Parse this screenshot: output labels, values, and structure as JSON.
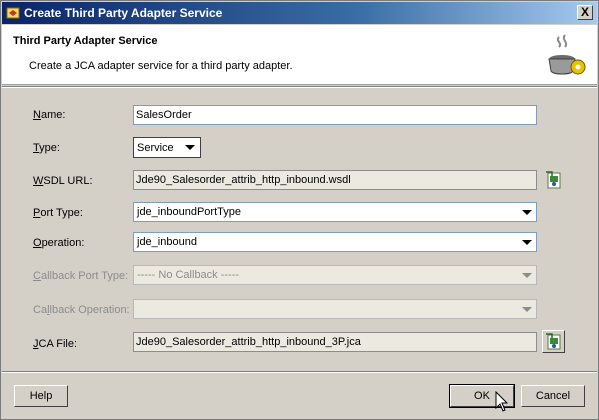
{
  "window": {
    "title": "Create Third Party Adapter Service",
    "close_label": "X"
  },
  "header": {
    "title": "Third Party Adapter Service",
    "subtitle": "Create a JCA adapter service for a third party adapter."
  },
  "form": {
    "name": {
      "label_first": "N",
      "label_rest": "ame:",
      "value": "SalesOrder"
    },
    "type": {
      "label_first": "T",
      "label_rest": "ype:",
      "value": "Service"
    },
    "wsdl_url": {
      "label_first": "W",
      "label_rest": "SDL URL:",
      "value": "Jde90_Salesorder_attrib_http_inbound.wsdl"
    },
    "port_type": {
      "label_first": "P",
      "label_rest": "ort Type:",
      "value": "jde_inboundPortType"
    },
    "operation": {
      "label_first": "O",
      "label_rest": "peration:",
      "value": "jde_inbound"
    },
    "callback_port_type": {
      "label_first": "C",
      "label_rest": "allback Port Type:",
      "value": "----- No Callback -----"
    },
    "callback_operation": {
      "label_pre": "Ca",
      "label_mid": "l",
      "label_rest": "lback Operation:",
      "value": ""
    },
    "jca_file": {
      "label_first": "J",
      "label_rest": "CA File:",
      "value": "Jde90_Salesorder_attrib_http_inbound_3P.jca"
    }
  },
  "buttons": {
    "help": "Help",
    "ok": "OK",
    "cancel": "Cancel"
  },
  "colors": {
    "title_bar_start": "#0a246a",
    "title_bar_end": "#a6caf0",
    "dialog_bg": "#d4d0c8"
  },
  "icons": {
    "app": "adapter-app-icon",
    "header": "coffee-cup-gear-icon",
    "browse_wsdl": "browse-wsdl-icon",
    "browse_jca": "browse-jca-icon",
    "cursor": "mouse-pointer-icon"
  }
}
